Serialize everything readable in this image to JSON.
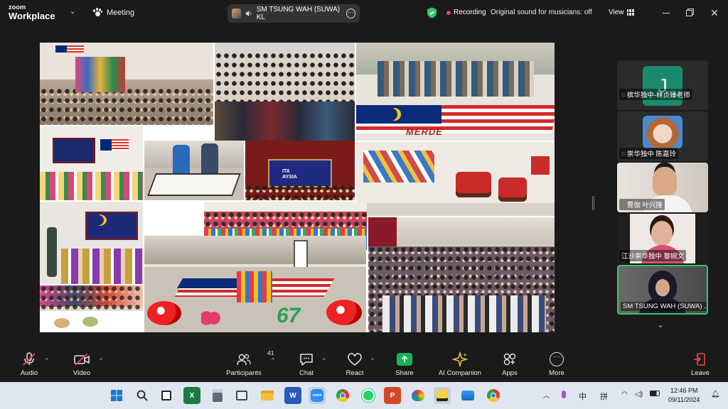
{
  "app": {
    "logo_line1": "zoom",
    "logo_line2": "Workplace",
    "meeting_label": "Meeting",
    "active_speaker": "SM TSUNG WAH (SUWA) KL",
    "recording_label": "Recording",
    "sound_status": "Original sound for musicians: off",
    "view_label": "View"
  },
  "participants": [
    {
      "name": "槟华独中-林贞臻老师",
      "muted": true,
      "avatar_letter": "J",
      "avatar_color": "#1a8a6e"
    },
    {
      "name": "崇华独中 陈嘉玲",
      "muted": true
    },
    {
      "name": "曹伽 叶兴隆",
      "muted": true
    },
    {
      "name": "江沙崇华独中 黎婉文",
      "muted": false
    },
    {
      "name": "SM TSUNG WAH (SUWA) ...",
      "muted": false,
      "active": true
    }
  ],
  "toolbar": {
    "audio": "Audio",
    "video": "Video",
    "participants": "Participants",
    "participants_count": "41",
    "chat": "Chat",
    "react": "React",
    "share": "Share",
    "ai_companion": "AI Companion",
    "apps": "Apps",
    "more": "More",
    "leave": "Leave"
  },
  "tray": {
    "ime1": "中",
    "ime2": "拼",
    "time": "12:46 PM",
    "date": "09/11/2024"
  },
  "collage_text": {
    "banner": "MERDE",
    "school_number": "67",
    "screen_text": "ITA\nAYSIA"
  },
  "colors": {
    "accent_green": "#2fc96a",
    "share_green": "#19b45a",
    "leave_red": "#e8464b",
    "recording_red": "#e8464b"
  }
}
